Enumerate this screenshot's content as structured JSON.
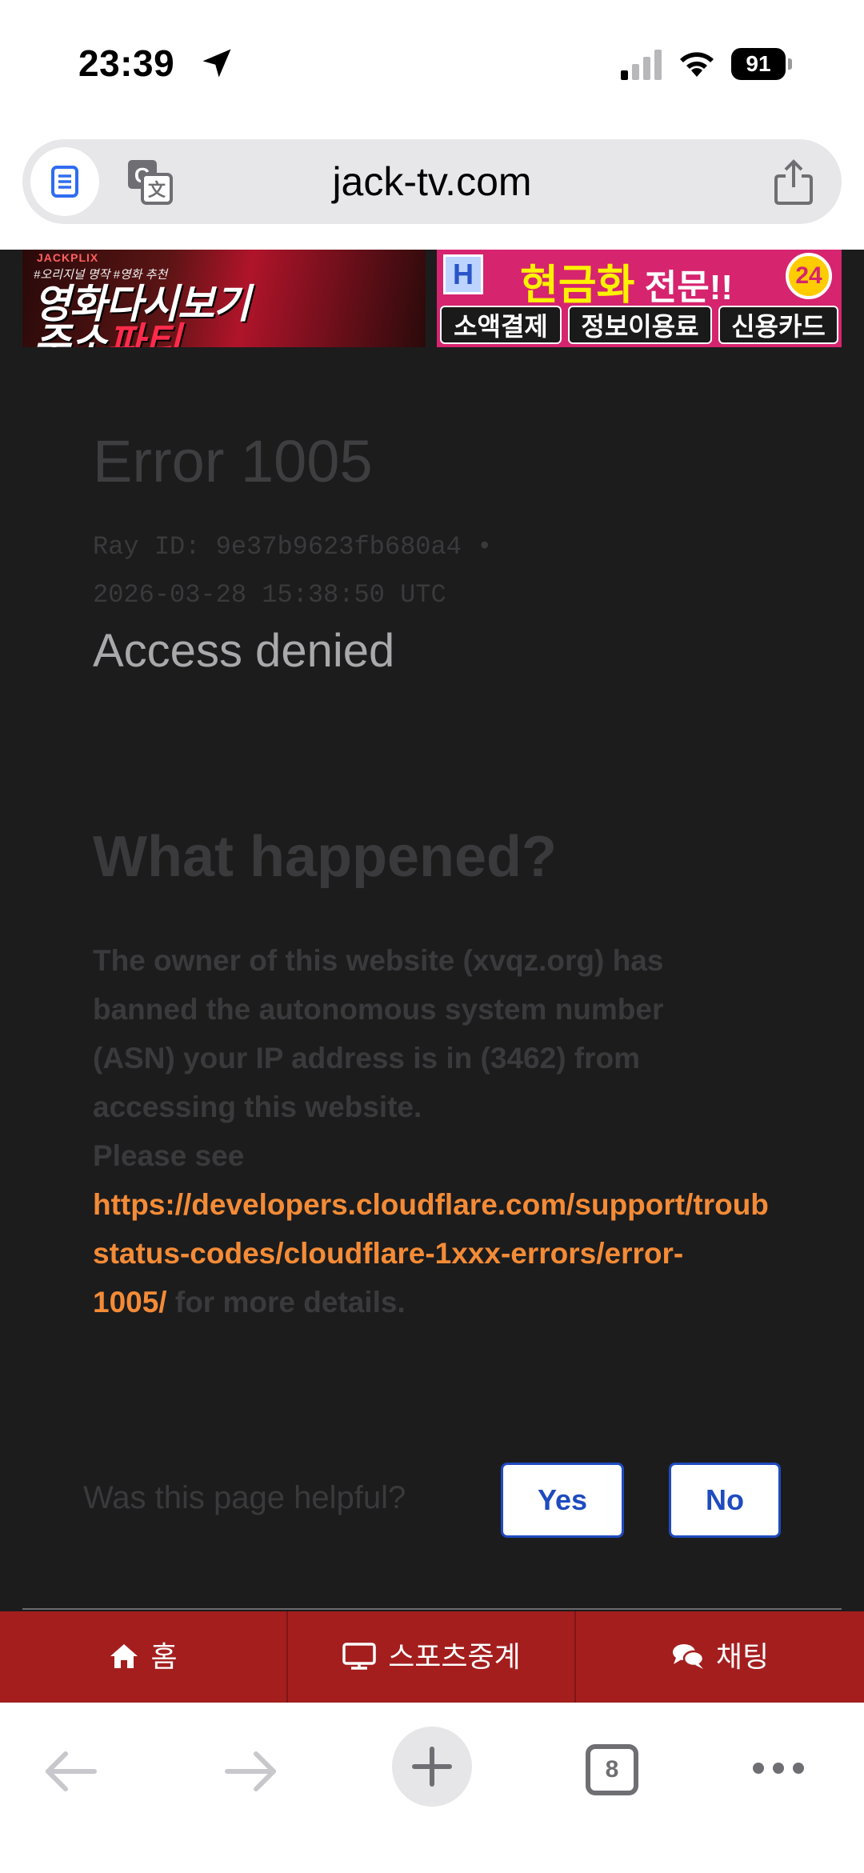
{
  "status_bar": {
    "time": "23:39",
    "battery": "91"
  },
  "browser": {
    "url": "jack-tv.com",
    "tab_count": "8"
  },
  "banners": {
    "left": {
      "brand": "JACKPLIX",
      "tags": "#오리지널 명작  #영화 추천",
      "line1": "영화다시보기",
      "line2_a": "주소",
      "line2_b": "파티"
    },
    "right": {
      "badge": "H",
      "title_a": "현금화",
      "title_b": " 전문!!",
      "circle": "24",
      "pills": [
        "소액결제",
        "정보이용료",
        "신용카드"
      ]
    }
  },
  "error": {
    "title": "Error 1005",
    "ray_line1": "Ray ID: 9e37b9623fb680a4 •",
    "ray_line2": "2026-03-28 15:38:50 UTC",
    "subtitle": "Access denied",
    "heading": "What happened?",
    "desc_line1": "The owner of this website (xvqz.org) has",
    "desc_line2": "banned the autonomous system number",
    "desc_line3": "(ASN) your IP address is in (3462) from",
    "desc_line4": "accessing this website.",
    "desc_line5": "Please see",
    "link_line1": "https://developers.cloudflare.com/support/troub",
    "link_line2": "status-codes/cloudflare-1xxx-errors/error-",
    "link_line3": "1005/",
    "link_after": " for more details."
  },
  "feedback": {
    "question": "Was this page helpful?",
    "yes": "Yes",
    "no": "No"
  },
  "site_nav": [
    {
      "label": "홈",
      "icon": "home-icon"
    },
    {
      "label": "스포츠중계",
      "icon": "monitor-icon"
    },
    {
      "label": "채팅",
      "icon": "chat-icon"
    }
  ],
  "colors": {
    "nav_red": "#a41e1e",
    "link_orange": "#f48b36",
    "button_blue": "#1f4bbf",
    "page_bg": "#1c1c1d"
  }
}
